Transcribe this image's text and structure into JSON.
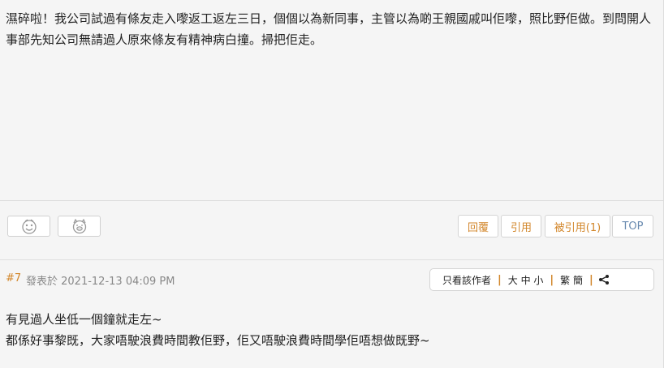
{
  "post6": {
    "text": "濕碎啦！我公司試過有條友走入嚟返工返左三日，個個以為新同事，主管以為啲王親國戚叫佢嚟，照比野佢做。到問開人事部先知公司無請過人原來條友有精神病白撞。掃把佢走。"
  },
  "actions": {
    "reply": "回覆",
    "quote": "引用",
    "quoted": "被引用(1)",
    "top": "TOP"
  },
  "post7": {
    "floor": "#7",
    "posted_label": "發表於 2021-12-13 04:09 PM",
    "toolbar": {
      "author_only": "只看該作者",
      "font_size": "大 中 小",
      "script": "繁 簡",
      "sep": "|"
    },
    "lines": [
      "有見過人坐低一個鐘就走左~",
      "都係好事黎既，大家唔駛浪費時間教佢野，佢又唔駛浪費時間學佢唔想做既野~"
    ]
  },
  "icons": {
    "react1": "smiley-face-icon",
    "react2": "pig-face-icon",
    "share": "share-icon"
  },
  "colors": {
    "accent": "#d2862a",
    "top_link": "#6a8bb0",
    "background": "#f5f5f5"
  }
}
